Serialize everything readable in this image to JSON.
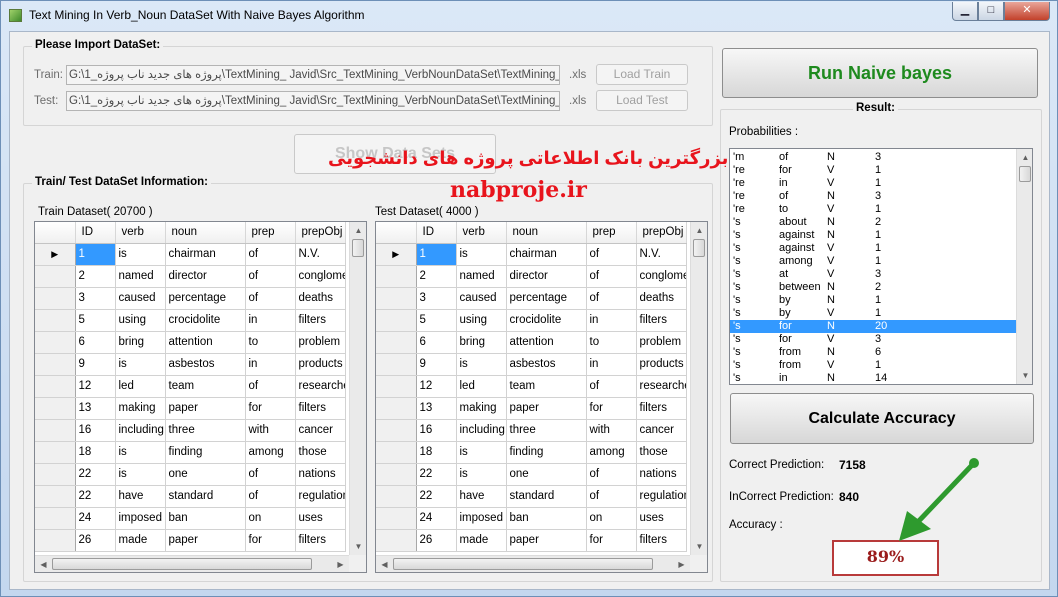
{
  "window": {
    "title": "Text Mining In Verb_Noun DataSet With Naive Bayes Algorithm",
    "minimize": "▁",
    "maximize": "□",
    "close": "✕"
  },
  "import": {
    "group_title": "Please Import DataSet:",
    "train_label": "Train:",
    "train_path": "G:\\1_پروژه های جدید ناب پروژه\\TextMining_ Javid\\Src_TextMining_VerbNounDataSet\\TextMining_Ve",
    "train_ext": ".xls",
    "load_train": "Load Train",
    "test_label": "Test:",
    "test_path": "G:\\1_پروژه های جدید ناب پروژه\\TextMining_ Javid\\Src_TextMining_VerbNounDataSet\\TextMining_Ve",
    "test_ext": ".xls",
    "load_test": "Load Test"
  },
  "show_data_sets": "Show Data Sets",
  "info": {
    "group_title": "Train/ Test DataSet Information:",
    "train_caption": "Train Dataset( 20700 )",
    "test_caption": "Test Dataset( 4000 )"
  },
  "grid_columns": [
    "ID",
    "verb",
    "noun",
    "prep",
    "prepObj"
  ],
  "grid_rows": [
    [
      "1",
      "is",
      "chairman",
      "of",
      "N.V."
    ],
    [
      "2",
      "named",
      "director",
      "of",
      "conglomerate"
    ],
    [
      "3",
      "caused",
      "percentage",
      "of",
      "deaths"
    ],
    [
      "5",
      "using",
      "crocidolite",
      "in",
      "filters"
    ],
    [
      "6",
      "bring",
      "attention",
      "to",
      "problem"
    ],
    [
      "9",
      "is",
      "asbestos",
      "in",
      "products"
    ],
    [
      "12",
      "led",
      "team",
      "of",
      "researchers"
    ],
    [
      "13",
      "making",
      "paper",
      "for",
      "filters"
    ],
    [
      "16",
      "including",
      "three",
      "with",
      "cancer"
    ],
    [
      "18",
      "is",
      "finding",
      "among",
      "those"
    ],
    [
      "22",
      "is",
      "one",
      "of",
      "nations"
    ],
    [
      "22",
      "have",
      "standard",
      "of",
      "regulation"
    ],
    [
      "24",
      "imposed",
      "ban",
      "on",
      "uses"
    ],
    [
      "26",
      "made",
      "paper",
      "for",
      "filters"
    ]
  ],
  "run_button": "Run Naive bayes",
  "result": {
    "group_title": "Result:",
    "probabilities_label": "Probabilities :",
    "probabilities": [
      [
        "'m",
        "of",
        "N",
        "3"
      ],
      [
        "'re",
        "for",
        "V",
        "1"
      ],
      [
        "'re",
        "in",
        "V",
        "1"
      ],
      [
        "'re",
        "of",
        "N",
        "3"
      ],
      [
        "'re",
        "to",
        "V",
        "1"
      ],
      [
        "'s",
        "about",
        "N",
        "2"
      ],
      [
        "'s",
        "against",
        "N",
        "1"
      ],
      [
        "'s",
        "against",
        "V",
        "1"
      ],
      [
        "'s",
        "among",
        "V",
        "1"
      ],
      [
        "'s",
        "at",
        "V",
        "3"
      ],
      [
        "'s",
        "between",
        "N",
        "2"
      ],
      [
        "'s",
        "by",
        "N",
        "1"
      ],
      [
        "'s",
        "by",
        "V",
        "1"
      ],
      [
        "'s",
        "for",
        "N",
        "20"
      ],
      [
        "'s",
        "for",
        "V",
        "3"
      ],
      [
        "'s",
        "from",
        "N",
        "6"
      ],
      [
        "'s",
        "from",
        "V",
        "1"
      ],
      [
        "'s",
        "in",
        "N",
        "14"
      ]
    ],
    "selected_probability_index": 13,
    "calculate_button": "Calculate Accuracy",
    "correct_label": "Correct Prediction:",
    "correct_value": "7158",
    "incorrect_label": "InCorrect Prediction:",
    "incorrect_value": "840",
    "accuracy_label": "Accuracy :",
    "accuracy_value": "89%"
  },
  "watermark": {
    "persian_text": "بزرگترین بانک اطلاعاتی پروژه های دانشجویی",
    "site": "nabproje.ir"
  },
  "colors": {
    "selection": "#3399ff",
    "run_text": "#1e8a1e",
    "watermark": "#e8141c",
    "arrow": "#2e9a2e",
    "accuracy_border": "#b83a3a"
  }
}
